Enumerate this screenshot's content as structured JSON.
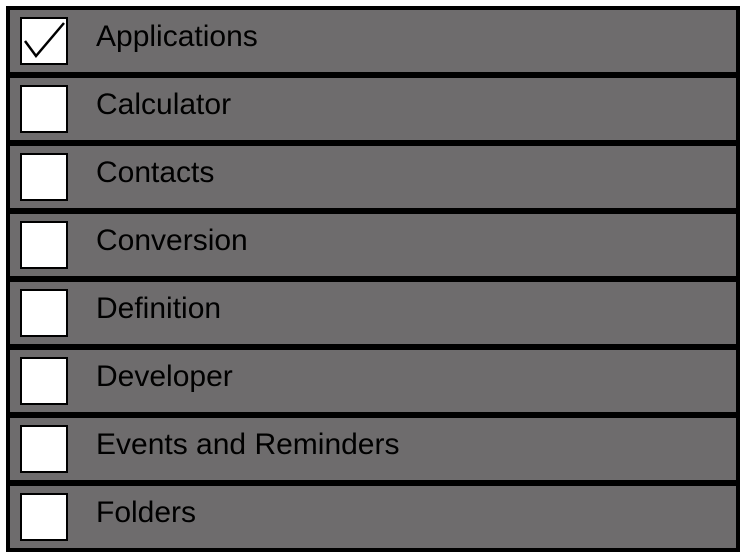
{
  "list": {
    "items": [
      {
        "label": "Applications",
        "checked": true
      },
      {
        "label": "Calculator",
        "checked": false
      },
      {
        "label": "Contacts",
        "checked": false
      },
      {
        "label": "Conversion",
        "checked": false
      },
      {
        "label": "Definition",
        "checked": false
      },
      {
        "label": "Developer",
        "checked": false
      },
      {
        "label": "Events and Reminders",
        "checked": false
      },
      {
        "label": "Folders",
        "checked": false
      }
    ]
  },
  "colors": {
    "row_background": "#6e6c6d",
    "separator": "#000000",
    "checkbox_fill": "#ffffff"
  }
}
